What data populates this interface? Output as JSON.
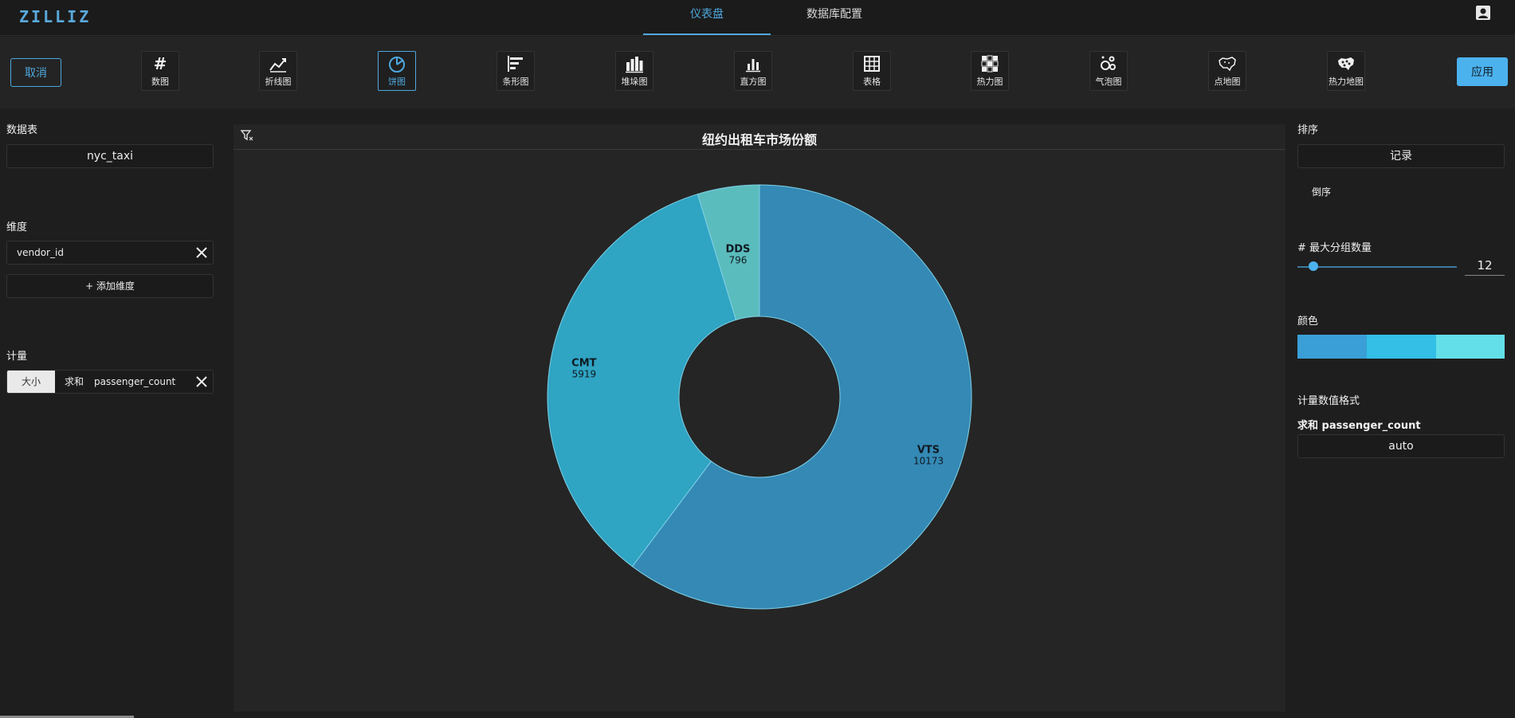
{
  "app": {
    "logo_text": "ZILLIZ",
    "nav_tabs": [
      "仪表盘",
      "数据库配置"
    ],
    "accent_color": "#4ea8de"
  },
  "toolbar": {
    "cancel_label": "取消",
    "apply_label": "应用",
    "chart_types": [
      {
        "label": "数图",
        "icon": "number-icon"
      },
      {
        "label": "折线图",
        "icon": "line-chart-icon"
      },
      {
        "label": "饼图",
        "icon": "pie-chart-icon",
        "selected": true
      },
      {
        "label": "条形图",
        "icon": "bar-chart-icon"
      },
      {
        "label": "堆垛图",
        "icon": "stacked-chart-icon"
      },
      {
        "label": "直方图",
        "icon": "histogram-icon"
      },
      {
        "label": "表格",
        "icon": "table-icon"
      },
      {
        "label": "热力图",
        "icon": "heatmap-icon"
      },
      {
        "label": "气泡图",
        "icon": "bubble-chart-icon"
      },
      {
        "label": "点地图",
        "icon": "point-map-icon"
      },
      {
        "label": "热力地图",
        "icon": "heat-map-icon"
      }
    ]
  },
  "left_panel": {
    "datatable_title": "数据表",
    "datatable_value": "nyc_taxi",
    "dimension_title": "维度",
    "dimension_value": "vendor_id",
    "add_dimension_label": "+ 添加维度",
    "measure_title": "计量",
    "measure_size_tag": "大小",
    "measure_agg": "求和",
    "measure_column": "passenger_count"
  },
  "chart": {
    "title": "纽约出租车市场份额"
  },
  "chart_data": {
    "type": "pie",
    "title": "纽约出租车市场份额",
    "donut": true,
    "categories": [
      "VTS",
      "CMT",
      "DDS"
    ],
    "values": [
      10173,
      5919,
      796
    ],
    "colors": [
      "#3489b5",
      "#2fa4c3",
      "#5bbcbd"
    ]
  },
  "right_panel": {
    "sort_title": "排序",
    "sort_value": "记录",
    "sort_order_label": "倒序",
    "max_groups_title": "# 最大分组数量",
    "max_groups_value": "12",
    "max_groups_fraction": 0.05,
    "color_title": "颜色",
    "color_swatches": [
      "#3a9fd6",
      "#33bfe6",
      "#62dfe8"
    ],
    "format_title": "计量数值格式",
    "format_measure": "求和 passenger_count",
    "format_value": "auto"
  }
}
